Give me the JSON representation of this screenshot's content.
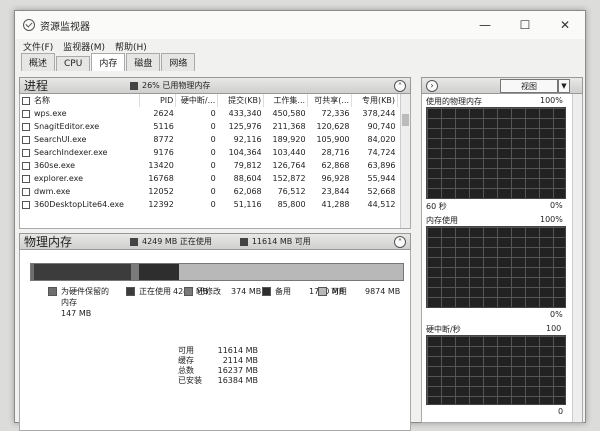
{
  "window": {
    "title": "资源监视器",
    "min_icon": "minimize-icon",
    "max_icon": "maximize-icon",
    "close_icon": "close-icon"
  },
  "menu": [
    "文件(F)",
    "监视器(M)",
    "帮助(H)"
  ],
  "tabs": [
    "概述",
    "CPU",
    "内存",
    "磁盘",
    "网络"
  ],
  "active_tab": "内存",
  "process": {
    "title": "进程",
    "info": "26% 已用物理内存",
    "columns": [
      "名称",
      "PID",
      "硬中断/...",
      "提交(KB)",
      "工作集...",
      "可共享(...",
      "专用(KB)"
    ],
    "rows": [
      [
        "wps.exe",
        "2624",
        "0",
        "433,340",
        "450,580",
        "72,336",
        "378,244"
      ],
      [
        "SnagitEditor.exe",
        "5116",
        "0",
        "125,976",
        "211,368",
        "120,628",
        "90,740"
      ],
      [
        "SearchUI.exe",
        "8772",
        "0",
        "92,116",
        "189,920",
        "105,900",
        "84,020"
      ],
      [
        "SearchIndexer.exe",
        "9176",
        "0",
        "104,364",
        "103,440",
        "28,716",
        "74,724"
      ],
      [
        "360se.exe",
        "13420",
        "0",
        "79,812",
        "126,764",
        "62,868",
        "63,896"
      ],
      [
        "explorer.exe",
        "16768",
        "0",
        "88,604",
        "152,872",
        "96,928",
        "55,944"
      ],
      [
        "dwm.exe",
        "12052",
        "0",
        "62,068",
        "76,512",
        "23,844",
        "52,668"
      ],
      [
        "360DesktopLite64.exe",
        "12392",
        "0",
        "51,116",
        "85,800",
        "41,288",
        "44,512"
      ]
    ]
  },
  "memory": {
    "title": "物理内存",
    "in_use_info": "4249 MB 正在使用",
    "available_info": "11614 MB 可用",
    "bar_mb": [
      147,
      4249,
      374,
      1740,
      9874
    ],
    "colors": [
      "#6e6e6e",
      "#3c3c3c",
      "#7a7a7a",
      "#2e2e2e",
      "#b8b8b8"
    ],
    "legend": [
      {
        "label1": "为硬件保留的",
        "label2": "内存",
        "value": "147 MB"
      },
      {
        "label1": "正在使用",
        "label2": "",
        "value": "4249 MB"
      },
      {
        "label1": "已修改",
        "label2": "",
        "value": "374 MB"
      },
      {
        "label1": "备用",
        "label2": "",
        "value": "1740 MB"
      },
      {
        "label1": "可用",
        "label2": "",
        "value": "9874 MB"
      }
    ],
    "totals": [
      {
        "k": "可用",
        "v": "11614 MB"
      },
      {
        "k": "缓存",
        "v": "2114 MB"
      },
      {
        "k": "总数",
        "v": "16237 MB"
      },
      {
        "k": "已安装",
        "v": "16384 MB"
      }
    ]
  },
  "right": {
    "view_label": "视图",
    "graphs": [
      {
        "title": "使用的物理内存",
        "max": "100%",
        "min": "0%",
        "time": "60 秒"
      },
      {
        "title": "内存使用",
        "max": "100%",
        "min": "0%",
        "time": ""
      },
      {
        "title": "硬中断/秒",
        "max": "100",
        "min": "0",
        "time": ""
      }
    ]
  }
}
